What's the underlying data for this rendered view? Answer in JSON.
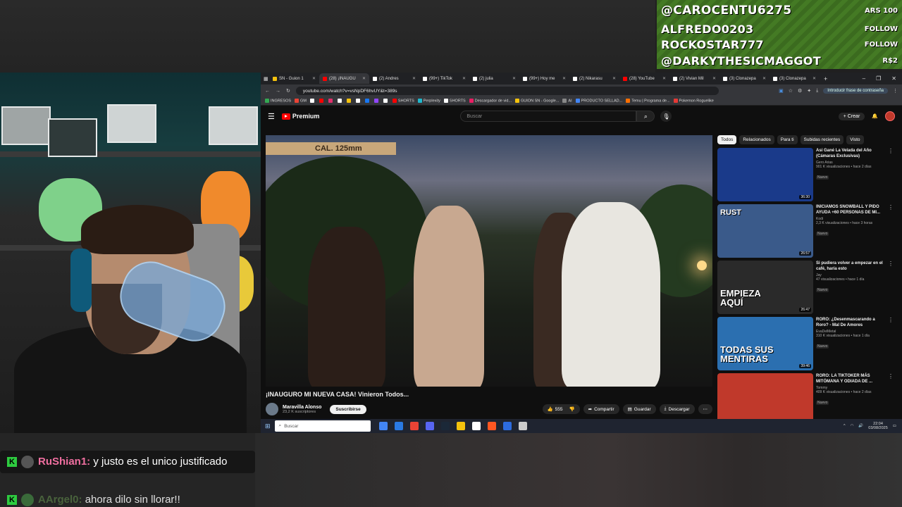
{
  "alerts": [
    {
      "name": "@CAROCENTU6275",
      "tag": "ARS 100"
    },
    {
      "name": "ALFREDO0203",
      "tag": "FOLLOW"
    },
    {
      "name": "ROCKOSTAR777",
      "tag": "FOLLOW"
    },
    {
      "name": "@DARKYTHESICMAGGOT",
      "tag": "R$2"
    }
  ],
  "chat": [
    {
      "badge": "K",
      "user": "RuShian1:",
      "text": "y justo es el unico justificado"
    },
    {
      "badge": "K",
      "user": "AArgel0:",
      "text": "ahora dilo sin llorar!!"
    }
  ],
  "browser": {
    "tabs": [
      {
        "label": "SN - Guion 1",
        "color": "#f4c20d"
      },
      {
        "label": "(28) ¡INAUGU",
        "color": "#ff0000",
        "active": true
      },
      {
        "label": "(2) Andres",
        "color": "#ffffff"
      },
      {
        "label": "(99+) TikTok",
        "color": "#ffffff"
      },
      {
        "label": "(2) julia",
        "color": "#ffffff"
      },
      {
        "label": "(99+) Hoy me",
        "color": "#ffffff"
      },
      {
        "label": "(2) Nikarasu",
        "color": "#ffffff"
      },
      {
        "label": "(28) YouTube",
        "color": "#ff0000"
      },
      {
        "label": "(2) Vivian Mil",
        "color": "#ffffff"
      },
      {
        "label": "(3) Clonazepa",
        "color": "#ffffff"
      },
      {
        "label": "(3) Clonazepa",
        "color": "#ffffff"
      }
    ],
    "url": "youtube.com/watch?v=vsNpDF6hvUY&t=389s",
    "profile_chip": "Introducir frase de contraseña",
    "bookmarks": [
      {
        "label": "INGRESOS",
        "color": "#34a853"
      },
      {
        "label": "GM",
        "color": "#ea4335"
      },
      {
        "label": "",
        "color": "#ffffff"
      },
      {
        "label": "",
        "color": "#ff0000"
      },
      {
        "label": "",
        "color": "#e1306c"
      },
      {
        "label": "",
        "color": "#ffffff"
      },
      {
        "label": "",
        "color": "#f4c20d"
      },
      {
        "label": "",
        "color": "#ffffff"
      },
      {
        "label": "",
        "color": "#1877f2"
      },
      {
        "label": "",
        "color": "#9146ff"
      },
      {
        "label": "",
        "color": "#ffffff"
      },
      {
        "label": "SHORTS",
        "color": "#ff0000"
      },
      {
        "label": "Perplexity",
        "color": "#20b8cd"
      },
      {
        "label": "SHORTS",
        "color": "#ffffff"
      },
      {
        "label": "Descargador de vid...",
        "color": "#e91e63"
      },
      {
        "label": "GUION SN - Google...",
        "color": "#f4c20d"
      },
      {
        "label": "AI",
        "color": "#888888"
      },
      {
        "label": "PRODUCTO SELLAD...",
        "color": "#4285f4"
      },
      {
        "label": "Temu | Programa de...",
        "color": "#ff6f00"
      },
      {
        "label": "Pokemon Roguelike",
        "color": "#e53935"
      }
    ]
  },
  "youtube": {
    "logo": "Premium",
    "search_placeholder": "Buscar",
    "create_label": "+ Crear",
    "sign_text": "CAL. 125mm",
    "video_title": "¡INAUGURO MI NUEVA CASA! Vinieron Todos...",
    "channel_name": "Maravilla Alonso",
    "channel_subs": "23,2 K suscriptores",
    "subscribe_label": "Suscribirse",
    "likes": "555",
    "share_label": "Compartir",
    "save_label": "Guardar",
    "download_label": "Descargar",
    "chips": [
      "Todos",
      "Relacionados",
      "Para ti",
      "Subidas recientes",
      "Visto"
    ],
    "recommendations": [
      {
        "title": "Así Gané La Velada del Año (Cámaras Exclusivas)",
        "channel": "Gero Arias",
        "meta": "901 K visualizaciones • hace 2 días",
        "badge": "Nuevo",
        "duration": "36:30",
        "thumb_text": "",
        "thumb_color": "#1a3a8a"
      },
      {
        "title": "INICIAMOS SNOWBALL Y PIDO AYUDA +60 PERSONAS DE MI...",
        "channel": "Kodi",
        "meta": "2,3 K visualizaciones • hace 3 horas",
        "badge": "Nuevo",
        "duration": "26:57",
        "thumb_text": "RUST",
        "thumb_color": "#3a5a8a"
      },
      {
        "title": "Si pudiera volver a empezar en el café, haría esto",
        "channel": "Jay",
        "meta": "47 visualizaciones • hace 1 día",
        "badge": "Nuevo",
        "duration": "26:47",
        "thumb_text": "EMPIEZA AQUÍ",
        "thumb_color": "#2a2a2a"
      },
      {
        "title": "RORO: ¿Desenmascarando a Roro? - Mal De Amores",
        "channel": "EvaDelMetal",
        "meta": "310 K visualizaciones • hace 1 día",
        "badge": "Nuevo",
        "duration": "39:46",
        "thumb_text": "TODAS SUS MENTIRAS",
        "thumb_color": "#2b6fb0"
      },
      {
        "title": "RORO: LA TIKTOKER MÁS MITÓMANA Y ODIADA DE ...",
        "channel": "Tommy",
        "meta": "409 K visualizaciones • hace 2 días",
        "badge": "Nuevo",
        "duration": "",
        "thumb_text": "",
        "thumb_color": "#c0392b"
      }
    ]
  },
  "taskbar": {
    "search_placeholder": "Buscar",
    "time": "22:04",
    "date": "03/08/2025",
    "icons": [
      "#4285f4",
      "#2a7ae4",
      "#ea4335",
      "#5865f2",
      "#1b2838",
      "#f4c20d",
      "#ffffff",
      "#ff5722",
      "#2d6cdf",
      "#cccccc"
    ]
  }
}
